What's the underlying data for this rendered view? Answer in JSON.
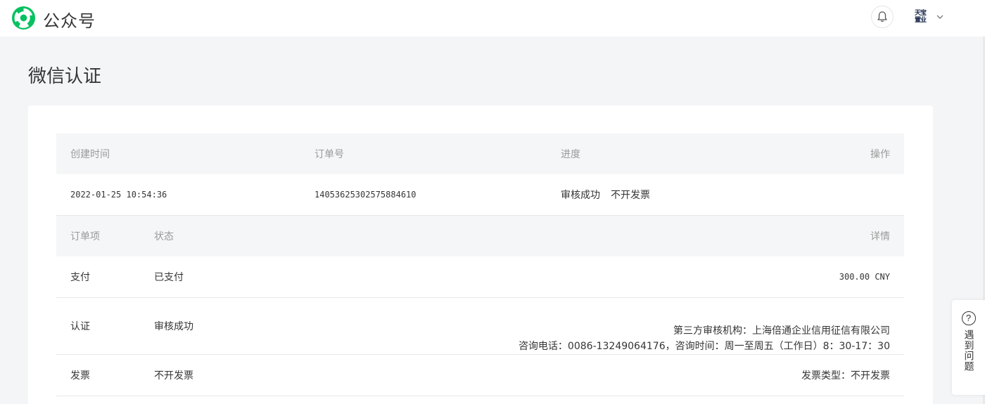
{
  "header": {
    "brand": "公众号",
    "account_badge_line1": "天宝",
    "account_badge_line2": "置业"
  },
  "page": {
    "title": "微信认证"
  },
  "order_table": {
    "columns": {
      "created": "创建时间",
      "order_no": "订单号",
      "progress": "进度",
      "action": "操作"
    },
    "row": {
      "created": "2022-01-25 10:54:36",
      "order_no": "14053625302575884610",
      "progress_status": "审核成功",
      "progress_invoice": "不开发票"
    }
  },
  "items_table": {
    "columns": {
      "item": "订单项",
      "status": "状态",
      "detail": "详情"
    },
    "rows": [
      {
        "item": "支付",
        "status": "已支付",
        "detail": "300.00 CNY"
      },
      {
        "item": "认证",
        "status": "审核成功",
        "detail_line1": "第三方审核机构：上海倍通企业信用征信有限公司",
        "detail_line2": "咨询电话：0086-13249064176，咨询时间：周一至周五（工作日）8：30-17：30"
      },
      {
        "item": "发票",
        "status": "不开发票",
        "detail": "发票类型：不开发票"
      }
    ]
  },
  "help": {
    "label": "遇到问题",
    "icon": "question-icon"
  },
  "colors": {
    "brand_green": "#07c160",
    "header_bg": "#f5f6f7",
    "text": "#353535",
    "muted": "#9a9a9a"
  }
}
